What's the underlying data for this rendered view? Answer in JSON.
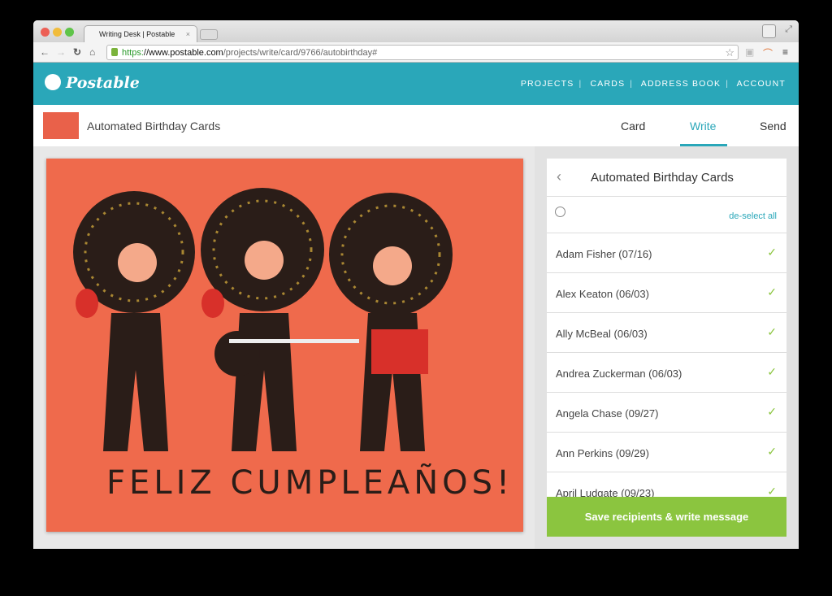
{
  "browser": {
    "tab_title": "Writing Desk | Postable",
    "url_scheme": "https:",
    "url_domain": "//www.postable.com",
    "url_path": "/projects/write/card/9766/autobirthday#"
  },
  "header": {
    "logo": "Postable",
    "nav": [
      "PROJECTS",
      "CARDS",
      "ADDRESS BOOK",
      "ACCOUNT"
    ]
  },
  "subheader": {
    "title": "Automated Birthday Cards",
    "steps": [
      "Card",
      "Write",
      "Send"
    ],
    "active_step": "Write"
  },
  "card": {
    "greeting": "FELIZ CUMPLEAÑOS!"
  },
  "panel": {
    "title": "Automated Birthday Cards",
    "deselect": "de-select all",
    "recipients": [
      {
        "name": "Adam Fisher (07/16)",
        "checked": true
      },
      {
        "name": "Alex Keaton (06/03)",
        "checked": true
      },
      {
        "name": "Ally McBeal (06/03)",
        "checked": true
      },
      {
        "name": "Andrea Zuckerman (06/03)",
        "checked": true
      },
      {
        "name": "Angela Chase (09/27)",
        "checked": true
      },
      {
        "name": "Ann Perkins (09/29)",
        "checked": true
      },
      {
        "name": "April Ludgate (09/23)",
        "checked": true
      }
    ],
    "save_label": "Save recipients & write message"
  },
  "colors": {
    "brand": "#2aa7b9",
    "success": "#8bc53f",
    "card_bg": "#ef6a4c"
  }
}
